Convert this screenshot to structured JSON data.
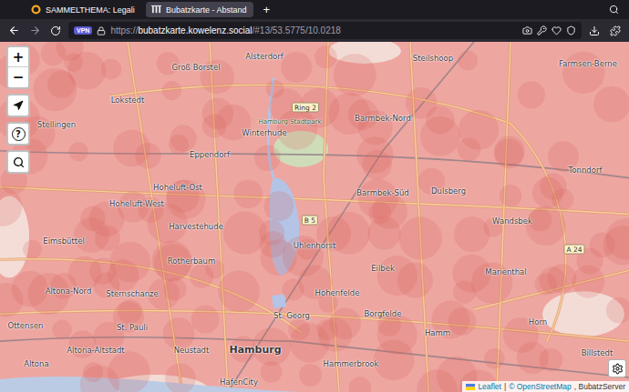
{
  "browser": {
    "tabs": [
      {
        "label": "SAMMELTHEMA: Legali",
        "selected": false
      },
      {
        "label": "Bubatzkarte - Abstand",
        "selected": true
      }
    ],
    "new_tab": "+",
    "address": {
      "vpn": "VPN",
      "scheme": "https://",
      "host": "bubatzkarte.kowelenz.social",
      "path": "/#13/53.5775/10.0218"
    }
  },
  "map": {
    "zoom": {
      "in": "+",
      "out": "−"
    },
    "help": "?",
    "labels": [
      {
        "text": "Groß Borstel",
        "kind": "district"
      },
      {
        "text": "Alsterdorf",
        "kind": "district"
      },
      {
        "text": "Steilshoop",
        "kind": "district"
      },
      {
        "text": "Farmsen-Berne",
        "kind": "district"
      },
      {
        "text": "Lokstedt",
        "kind": "district"
      },
      {
        "text": "Ring 2",
        "kind": "road"
      },
      {
        "text": "Hamburg Stadtpark",
        "kind": "park"
      },
      {
        "text": "Winterhude",
        "kind": "district"
      },
      {
        "text": "Barmbek-Nord",
        "kind": "district"
      },
      {
        "text": "Stellingen",
        "kind": "district"
      },
      {
        "text": "Eppendorf",
        "kind": "district"
      },
      {
        "text": "Tonndorf",
        "kind": "district"
      },
      {
        "text": "Hoheluft-Ost",
        "kind": "district"
      },
      {
        "text": "Barmbek-Süd",
        "kind": "district"
      },
      {
        "text": "Dulsberg",
        "kind": "district"
      },
      {
        "text": "Hoheluft-West",
        "kind": "district"
      },
      {
        "text": "B 5",
        "kind": "road"
      },
      {
        "text": "Wandsbek",
        "kind": "district"
      },
      {
        "text": "Harvestehude",
        "kind": "district"
      },
      {
        "text": "Eimsbüttel",
        "kind": "district"
      },
      {
        "text": "Uhlenhorst",
        "kind": "district"
      },
      {
        "text": "A 24",
        "kind": "road"
      },
      {
        "text": "Rotherbaum",
        "kind": "district"
      },
      {
        "text": "Eilbek",
        "kind": "district"
      },
      {
        "text": "Marienthal",
        "kind": "district"
      },
      {
        "text": "Altona-Nord",
        "kind": "district"
      },
      {
        "text": "Sternschanze",
        "kind": "district"
      },
      {
        "text": "Hohenfelde",
        "kind": "district"
      },
      {
        "text": "Borgfelde",
        "kind": "district"
      },
      {
        "text": "St. Georg",
        "kind": "district"
      },
      {
        "text": "Horn",
        "kind": "district"
      },
      {
        "text": "Ottensen",
        "kind": "district"
      },
      {
        "text": "St. Pauli",
        "kind": "district"
      },
      {
        "text": "Hamm",
        "kind": "district"
      },
      {
        "text": "Altona-Altstadt",
        "kind": "district"
      },
      {
        "text": "Neustadt",
        "kind": "district"
      },
      {
        "text": "Hamburg",
        "kind": "city"
      },
      {
        "text": "Billstedt",
        "kind": "district"
      },
      {
        "text": "Hammerbrook",
        "kind": "district"
      },
      {
        "text": "Altona",
        "kind": "district"
      },
      {
        "text": "HafenCity",
        "kind": "district"
      }
    ],
    "attribution": {
      "leaflet": "Leaflet",
      "separator": "|",
      "osm": "© OpenStreetMap",
      "extra": ", BubatzServer"
    }
  }
}
